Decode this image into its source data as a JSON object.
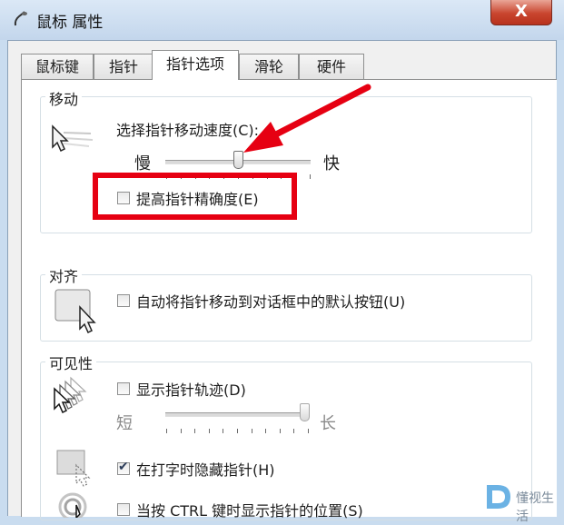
{
  "window": {
    "title": "鼠标 属性",
    "close_label": "X"
  },
  "tabs": [
    {
      "label": "鼠标键"
    },
    {
      "label": "指针"
    },
    {
      "label": "指针选项",
      "active": true
    },
    {
      "label": "滑轮"
    },
    {
      "label": "硬件"
    }
  ],
  "motion": {
    "group_label": "移动",
    "speed_label": "选择指针移动速度(C):",
    "slow_label": "慢",
    "fast_label": "快",
    "speed_value_fraction": 0.5,
    "precision_label": "提高指针精确度(E)",
    "precision_checked": false
  },
  "snap": {
    "group_label": "对齐",
    "snap_label": "自动将指针移动到对话框中的默认按钮(U)",
    "snap_checked": false
  },
  "visibility": {
    "group_label": "可见性",
    "trails_label": "显示指针轨迹(D)",
    "trails_checked": false,
    "short_label": "短",
    "long_label": "长",
    "trail_value_fraction": 1.0,
    "hide_label": "在打字时隐藏指针(H)",
    "hide_checked": true,
    "ctrl_label": "当按 CTRL 键时显示指针的位置(S)",
    "ctrl_checked": false
  },
  "annotations": {
    "highlight_color": "#e60012",
    "arrow_color": "#e60012"
  },
  "watermark": {
    "text": "懂视生活"
  }
}
